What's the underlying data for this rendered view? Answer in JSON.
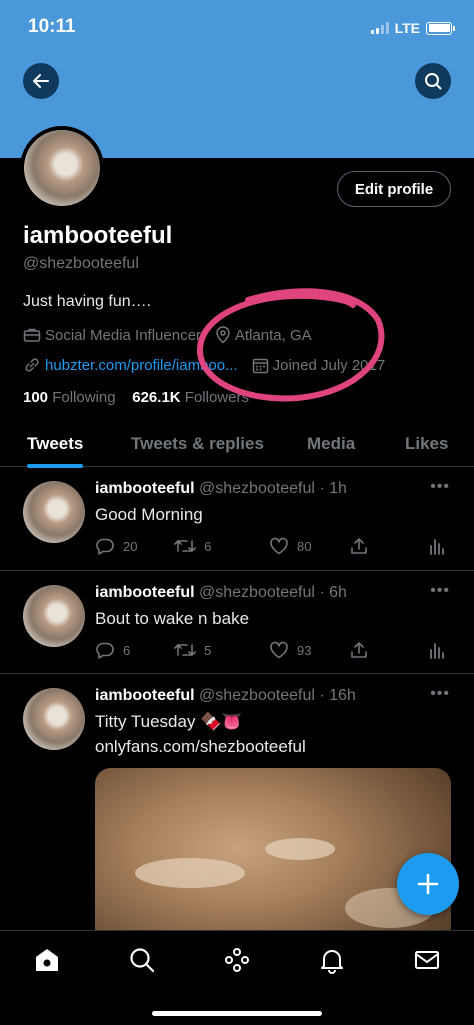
{
  "status_bar": {
    "time": "10:11",
    "network": "LTE"
  },
  "header": {
    "back_icon": "back-arrow-icon",
    "search_icon": "search-icon",
    "banner_color": "#4a97d9"
  },
  "profile": {
    "name": "iambooteeful",
    "handle": "@shezbooteeful",
    "bio": "Just having fun….",
    "category": "Social Media Influencer",
    "location": "Atlanta, GA",
    "link": "hubzter.com/profile/iamboo...",
    "joined": "Joined July 2017",
    "edit_label": "Edit profile",
    "following_count": "100",
    "following_label": "Following",
    "followers_count": "626.1K",
    "followers_label": "Followers"
  },
  "tabs": [
    {
      "label": "Tweets",
      "active": true
    },
    {
      "label": "Tweets & replies",
      "active": false
    },
    {
      "label": "Media",
      "active": false
    },
    {
      "label": "Likes",
      "active": false
    }
  ],
  "tweets": [
    {
      "name": "iambooteeful",
      "meta": "@shezbooteeful · 1h",
      "text": "Good Morning",
      "replies": "20",
      "retweets": "6",
      "likes": "80"
    },
    {
      "name": "iambooteeful",
      "meta": "@shezbooteeful · 6h",
      "text": "Bout to wake n bake",
      "replies": "6",
      "retweets": "5",
      "likes": "93"
    },
    {
      "name": "iambooteeful",
      "meta": "@shezbooteeful · 16h",
      "text": "Titty Tuesday 🍫👅",
      "link": "onlyfans.com/shezbooteeful"
    }
  ],
  "colors": {
    "accent": "#1d9bf0",
    "annotation_circle": "#e0447f"
  },
  "nav": [
    "home-icon",
    "search-icon",
    "spaces-icon",
    "notifications-icon",
    "messages-icon"
  ]
}
